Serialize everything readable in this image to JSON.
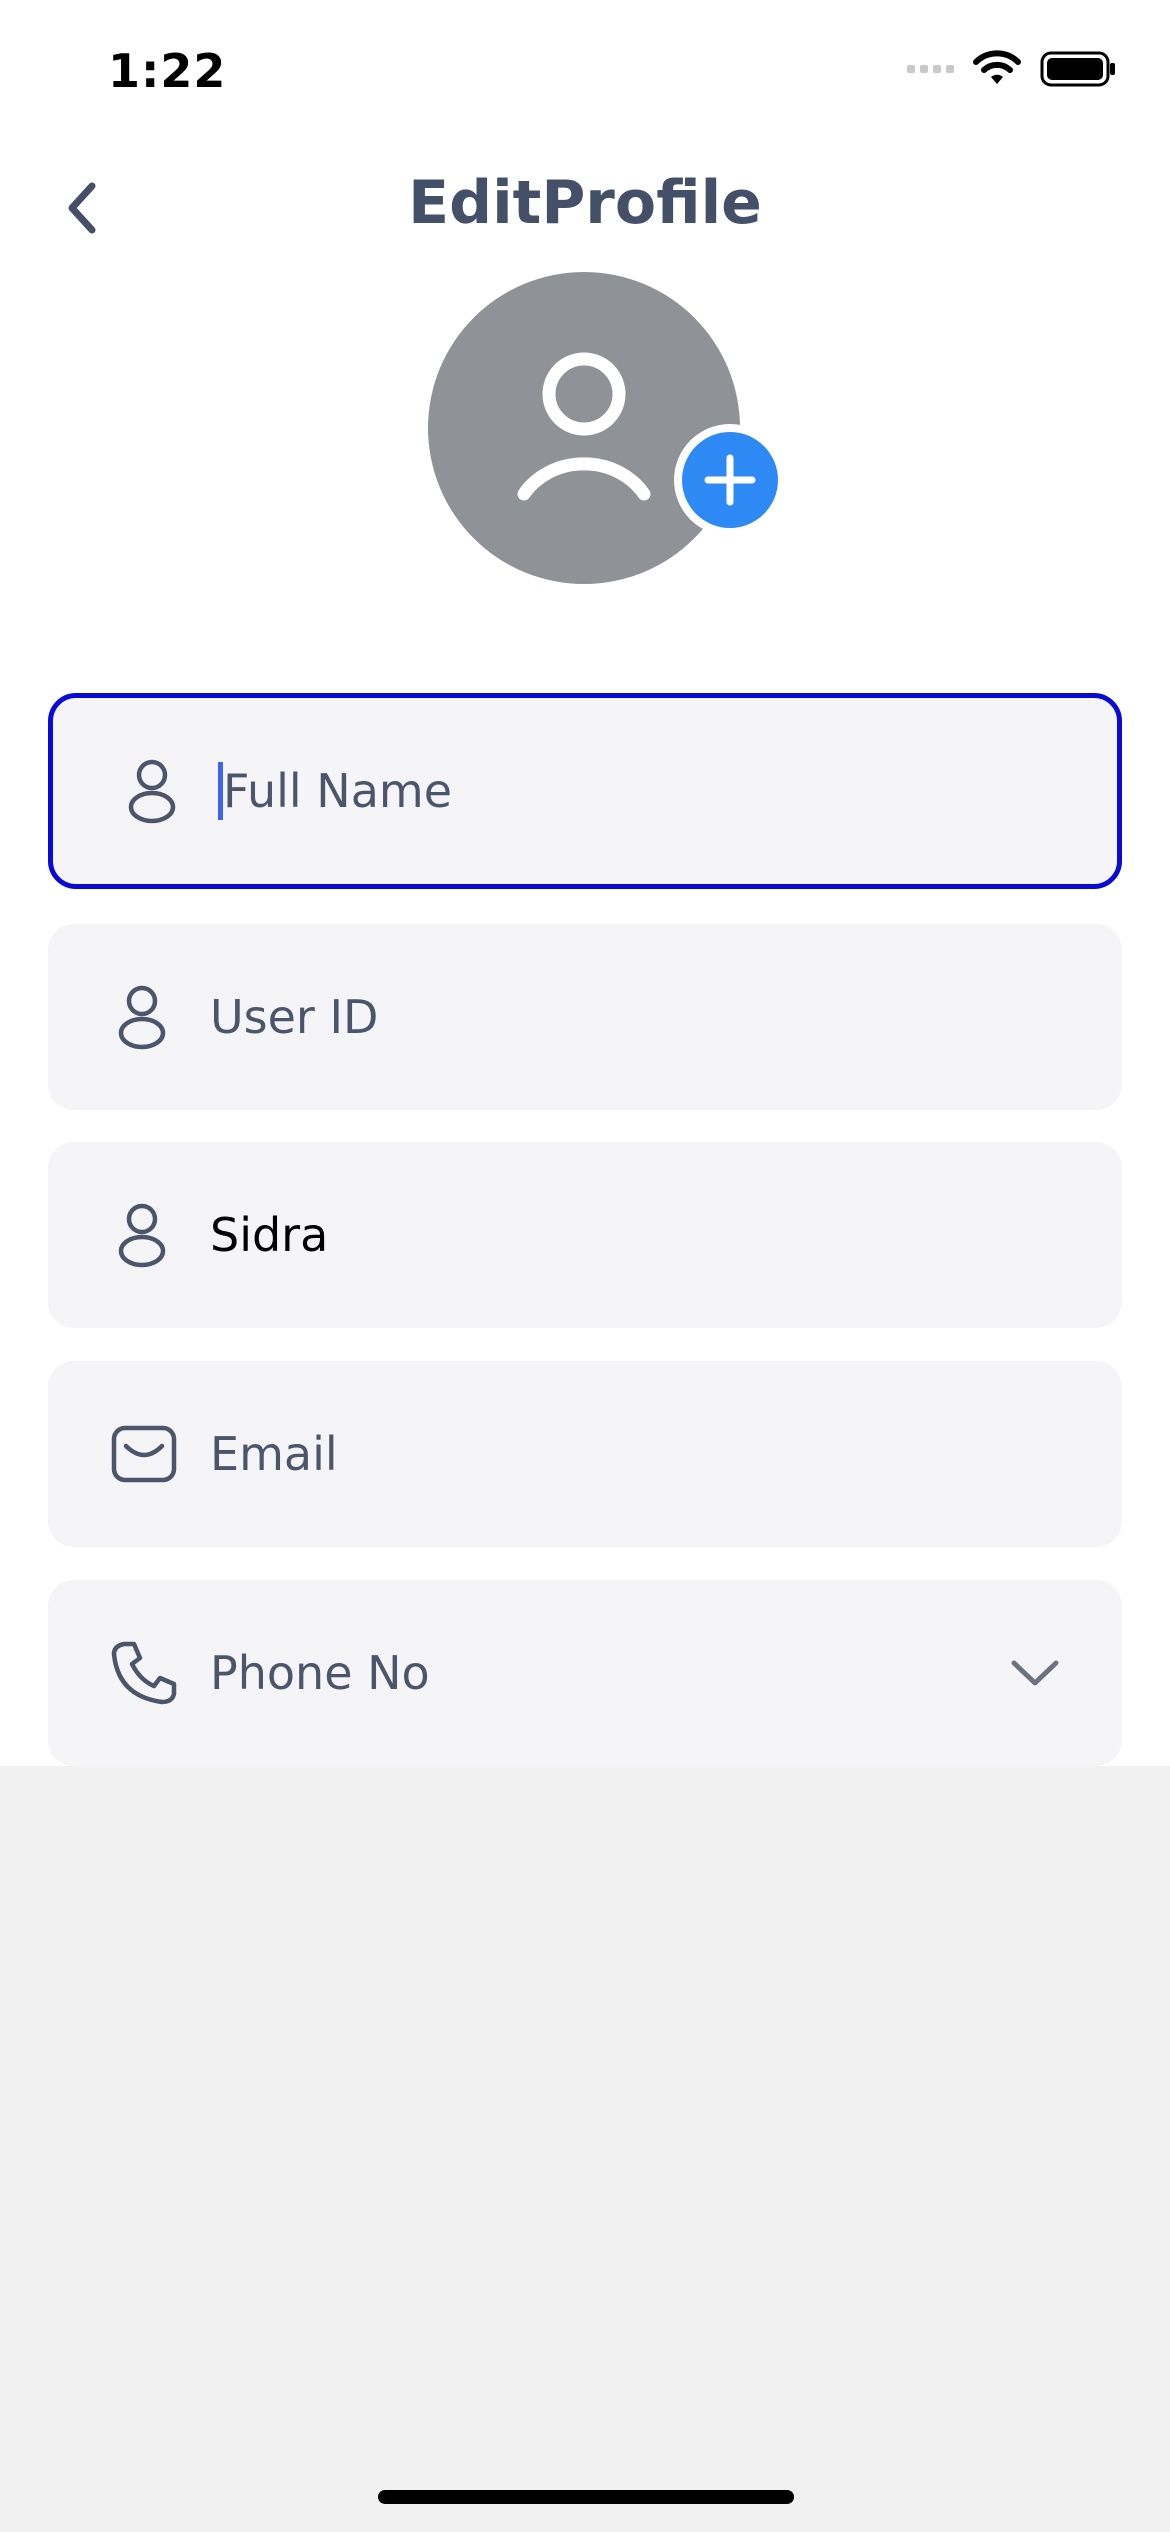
{
  "status_bar": {
    "time": "1:22"
  },
  "header": {
    "title": "EditProfile"
  },
  "fields": {
    "full_name_placeholder": "Full Name",
    "user_id_placeholder": "User ID",
    "name_value": "Sidra",
    "email_placeholder": "Email",
    "phone_placeholder": "Phone No"
  },
  "icons": {
    "back": "chevron-left-icon",
    "avatar": "user-icon",
    "add": "plus-icon",
    "email": "mail-icon",
    "phone": "phone-icon",
    "dropdown": "chevron-down-icon"
  },
  "colors": {
    "title": "#435067",
    "accent": "#2f89f5",
    "focus_border": "#0a0ad6",
    "field_bg": "#f5f5f7"
  }
}
